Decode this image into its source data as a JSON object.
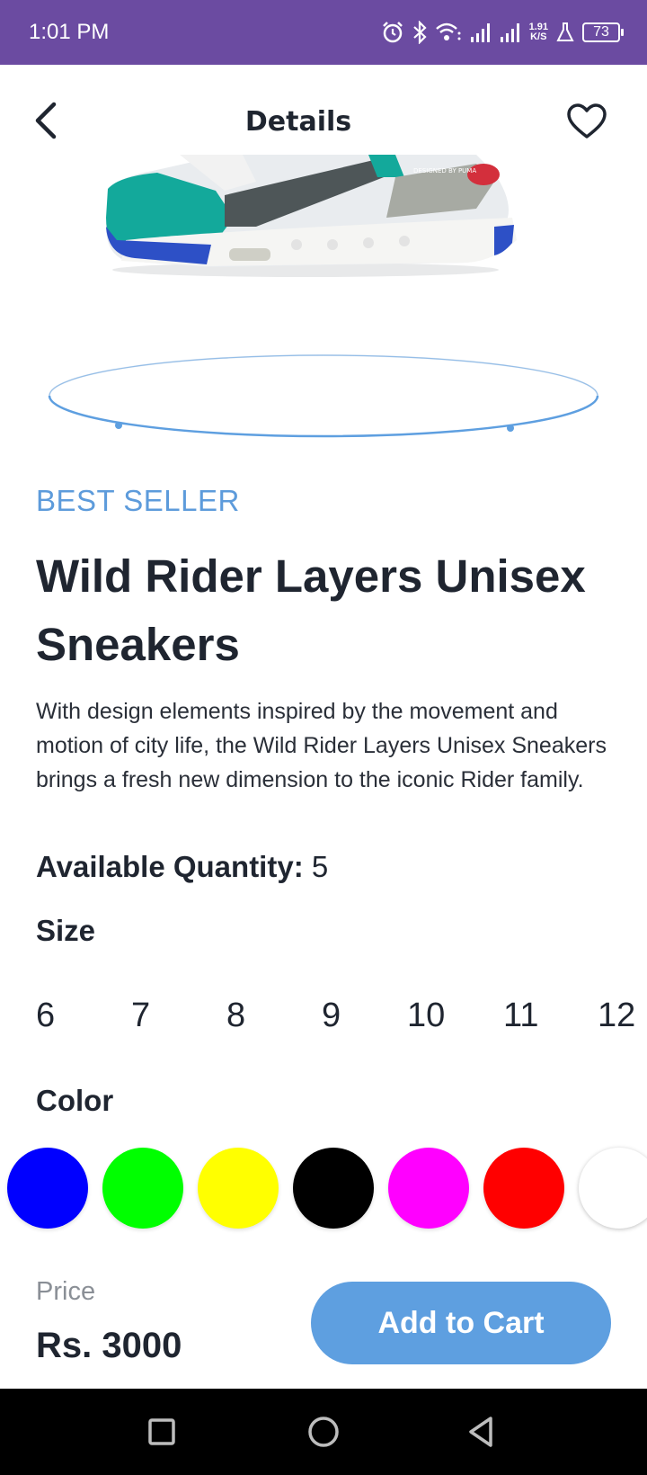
{
  "status_bar": {
    "time": "1:01 PM",
    "speed_value": "1.91",
    "speed_unit": "K/S",
    "battery": "73"
  },
  "header": {
    "title": "Details"
  },
  "product": {
    "badge": "BEST SELLER",
    "name": "Wild Rider Layers Unisex Sneakers",
    "description": "With design elements inspired by the movement and motion of city life, the Wild Rider Layers Unisex Sneakers brings a fresh new dimension to the iconic Rider family.",
    "quantity_label": "Available Quantity:",
    "quantity_value": "5",
    "shoe_print": "DESIGNED BY PUMA"
  },
  "size": {
    "label": "Size",
    "options": [
      "6",
      "7",
      "8",
      "9",
      "10",
      "11",
      "12"
    ]
  },
  "color": {
    "label": "Color",
    "options": [
      "#0000ff",
      "#00ff00",
      "#ffff00",
      "#000000",
      "#ff00ff",
      "#ff0000",
      "#ffffff"
    ]
  },
  "footer": {
    "price_label": "Price",
    "price_value": "Rs. 3000",
    "cart_button": "Add to Cart"
  },
  "colors": {
    "status_bar": "#6b4ba1",
    "accent": "#5e9fe0",
    "badge": "#5d9bdb"
  },
  "icons": {
    "back": "chevron-left-icon",
    "favorite": "heart-outline-icon",
    "nav_recents": "square-icon",
    "nav_home": "circle-icon",
    "nav_back": "triangle-back-icon"
  }
}
